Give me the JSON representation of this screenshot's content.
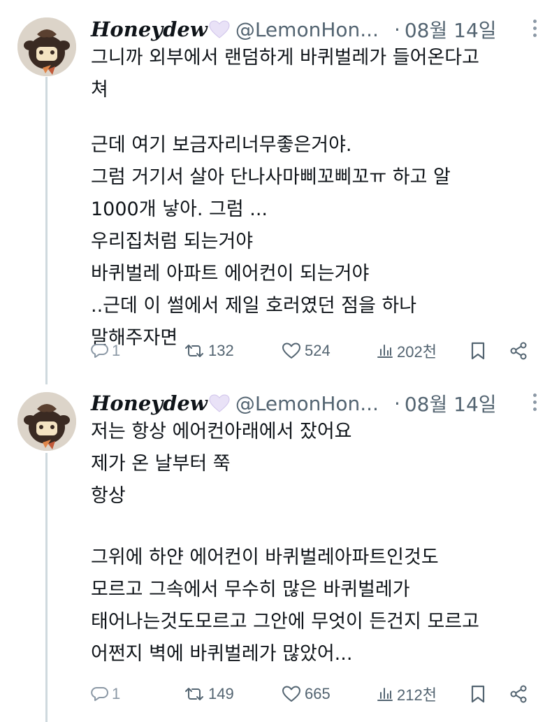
{
  "tweets": [
    {
      "display_name": "Honeydew",
      "handle": "@LemonHon...",
      "separator": "·",
      "date": "08월 14일",
      "lines": [
        "그니까 외부에서 랜덤하게 바퀴벌레가 들어온다고",
        "쳐",
        "근데 여기 보금자리너무좋은거야.",
        "그럼 거기서 살아 단나사마삐꼬삐꼬ㅠ 하고 알",
        "1000개 낳아. 그럼 ...",
        "우리집처럼 되는거야",
        "바퀴벌레 아파트 에어컨이 되는거야",
        "..근데 이 썰에서 제일 호러였던 점을 하나",
        "말해주자면"
      ],
      "replies": "1",
      "retweets": "132",
      "likes": "524",
      "views": "202천"
    },
    {
      "display_name": "Honeydew",
      "handle": "@LemonHon...",
      "separator": "·",
      "date": "08월 14일",
      "lines": [
        "저는 항상 에어컨아래에서 잤어요",
        "제가 온 날부터 쭉",
        "항상",
        "",
        "그위에 하얀 에어컨이 바퀴벌레아파트인것도",
        "모르고 그속에서 무수히 많은 바퀴벌레가",
        "태어나는것도모르고 그안에 무엇이 든건지 모르고",
        "어쩐지 벽에 바퀴벌레가 많았어..."
      ],
      "replies": "1",
      "retweets": "149",
      "likes": "665",
      "views": "212천"
    }
  ],
  "colors": {
    "text": "#0f1419",
    "secondary": "#536471",
    "thread_line": "#cfd9de",
    "heart": "#e9e2f7"
  },
  "icons": [
    "more-icon",
    "reply-icon",
    "retweet-icon",
    "like-icon",
    "views-icon",
    "bookmark-icon",
    "share-icon",
    "purple-heart-emoji"
  ]
}
